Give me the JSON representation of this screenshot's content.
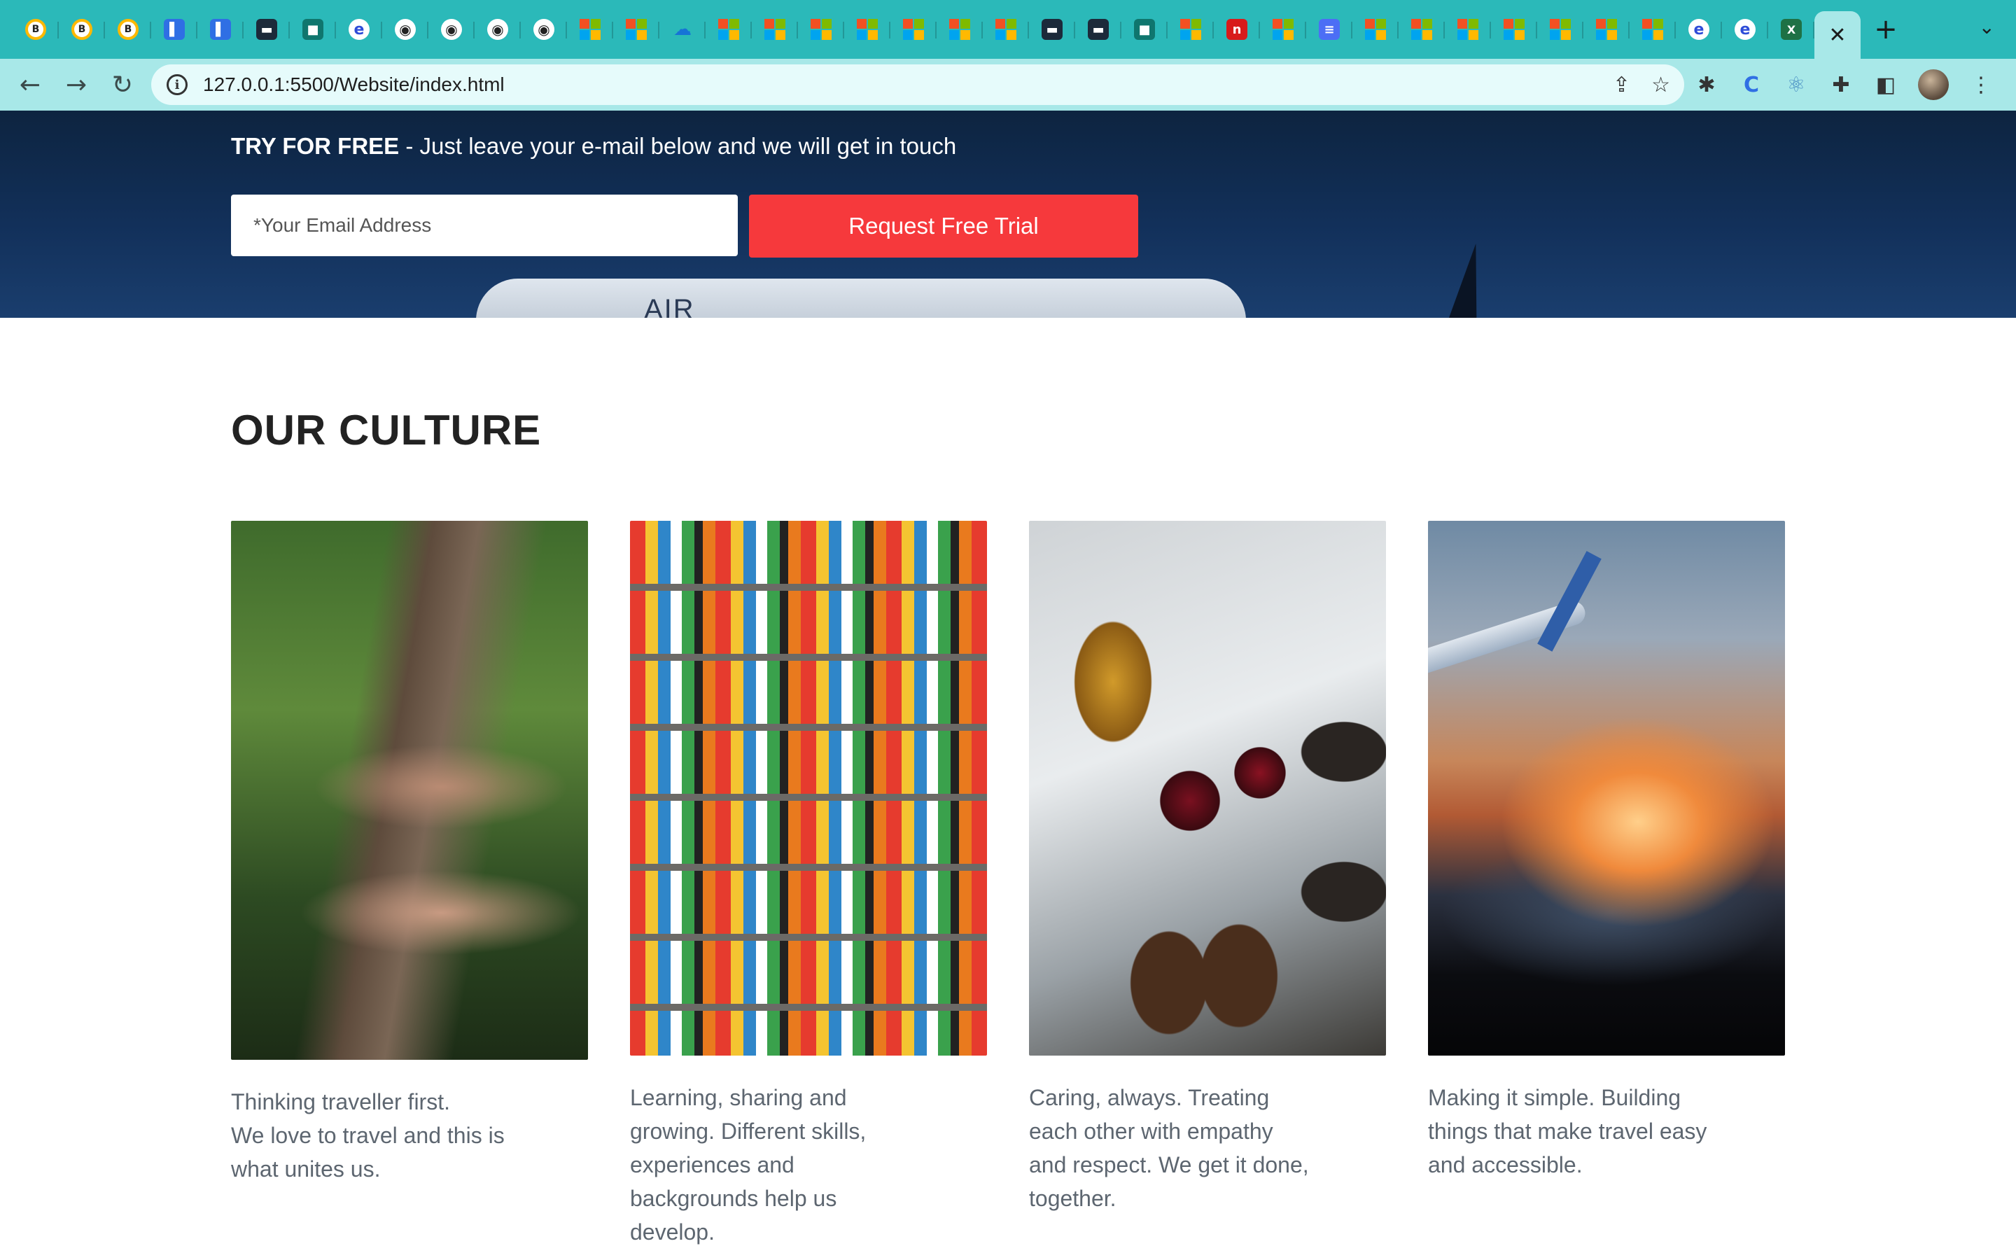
{
  "browser": {
    "tab_close_glyph": "✕",
    "new_tab_glyph": "+",
    "tab_menu_glyph": "⌄",
    "url": "127.0.0.1:5500/Website/index.html",
    "nav": {
      "back": "←",
      "forward": "→",
      "reload": "↻"
    },
    "omnibox_icons": {
      "share": "⇪",
      "bookmark": "☆"
    },
    "extension_glyphs": {
      "bug": "✱",
      "c": "C",
      "react": "⚛",
      "puzzle": "✚",
      "sidepanel": "◧",
      "menu": "⋮"
    },
    "favicons": [
      "rec",
      "rec",
      "rec",
      "blue",
      "blue",
      "dark",
      "teal",
      "q",
      "gh",
      "gh",
      "gh",
      "gh",
      "ms",
      "ms",
      "cloud",
      "ms",
      "ms",
      "ms",
      "ms",
      "ms",
      "ms",
      "ms",
      "dark",
      "dark",
      "teal",
      "ms",
      "red",
      "ms",
      "doc",
      "ms",
      "ms",
      "ms",
      "ms",
      "ms",
      "ms",
      "ms",
      "q",
      "q",
      "xl"
    ]
  },
  "hero": {
    "try_bold": "TRY FOR FREE",
    "try_rest": " - Just leave your e-mail below and we will get in touch",
    "email_placeholder": "*Your Email Address",
    "button_label": "Request Free Trial",
    "plane_livery": "AIR"
  },
  "culture": {
    "title": "OUR CULTURE",
    "cards": [
      {
        "lines": [
          "Thinking traveller first.",
          "We love to travel and this is",
          "what unites us."
        ]
      },
      {
        "lines": [
          "Learning, sharing and",
          "growing. Different skills,",
          "experiences and",
          "backgrounds help us",
          "develop."
        ]
      },
      {
        "lines": [
          "Caring, always. Treating",
          "each other with empathy",
          "and respect. We get it done,",
          "together."
        ]
      },
      {
        "lines": [
          "Making it simple. Building",
          "things that make travel easy",
          "and accessible."
        ]
      }
    ]
  },
  "colors": {
    "tabstrip": "#2bb9b9",
    "toolbar": "#a8e8e8",
    "cta": "#f6393c",
    "hero": "#0d2440"
  }
}
